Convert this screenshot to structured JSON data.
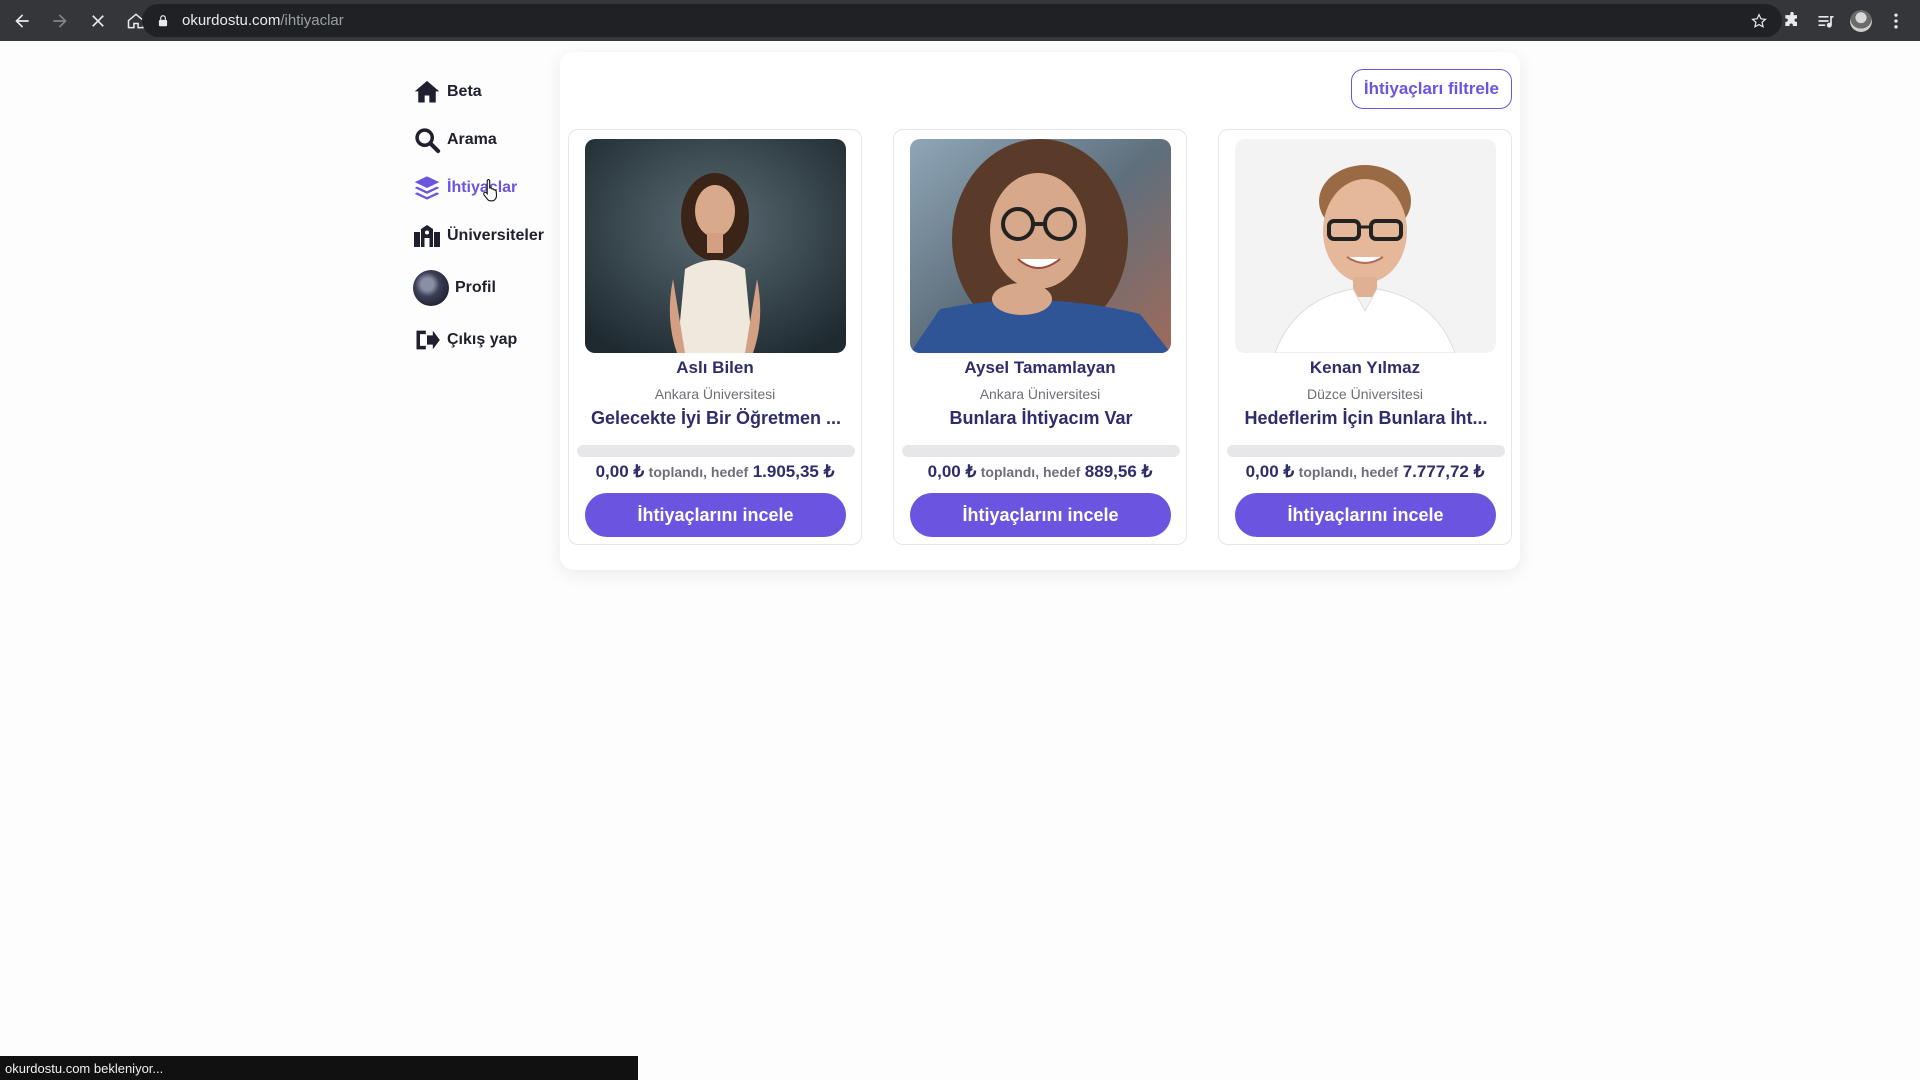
{
  "browser": {
    "url_domain": "okurdostu.com",
    "url_path": "/ihtiyaclar",
    "status_text": "okurdostu.com bekleniyor..."
  },
  "sidebar": {
    "items": [
      {
        "label": "Beta",
        "icon": "home-icon"
      },
      {
        "label": "Arama",
        "icon": "search-icon"
      },
      {
        "label": "İhtiyaçlar",
        "icon": "layers-icon",
        "active": true
      },
      {
        "label": "Üniversiteler",
        "icon": "university-icon"
      },
      {
        "label": "Profil",
        "icon": "avatar"
      },
      {
        "label": "Çıkış yap",
        "icon": "logout-icon"
      }
    ]
  },
  "main": {
    "filter_label": "İhtiyaçları filtrele",
    "cards": [
      {
        "name": "Aslı Bilen",
        "university": "Ankara Üniversitesi",
        "title": "Gelecekte İyi Bir Öğretmen ...",
        "collected": "0,00 ₺",
        "collected_label": "toplandı, hedef",
        "target": "1.905,35 ₺",
        "progress": 0,
        "button": "İhtiyaçlarını incele"
      },
      {
        "name": "Aysel Tamamlayan",
        "university": "Ankara Üniversitesi",
        "title": "Bunlara İhtiyacım Var",
        "collected": "0,00 ₺",
        "collected_label": "toplandı, hedef",
        "target": "889,56 ₺",
        "progress": 0,
        "button": "İhtiyaçlarını incele"
      },
      {
        "name": "Kenan Yılmaz",
        "university": "Düzce Üniversitesi",
        "title": "Hedeflerim İçin Bunlara İht...",
        "collected": "0,00 ₺",
        "collected_label": "toplandı, hedef",
        "target": "7.777,72 ₺",
        "progress": 0,
        "button": "İhtiyaçlarını incele"
      }
    ]
  },
  "colors": {
    "accent": "#6b54e0",
    "heading": "#2f2c6b",
    "muted": "#6e6e78"
  }
}
